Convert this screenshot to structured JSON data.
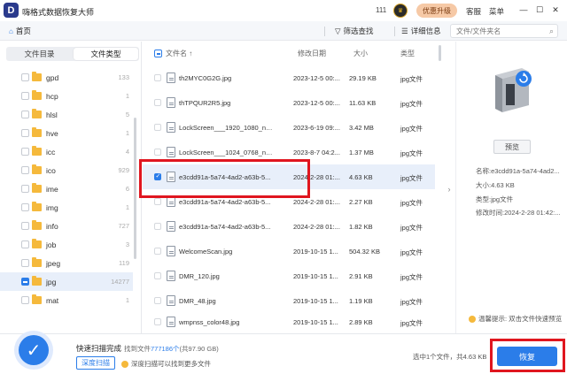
{
  "app": {
    "title": "嗨格式数据恢复大师",
    "logo_letter": "D",
    "count_badge": "111",
    "upgrade_label": "优惠升级",
    "support_label": "客服",
    "menu_label": "菜单"
  },
  "toolbar": {
    "home_label": "首页",
    "filter_label": "筛选查找",
    "details_label": "详细信息",
    "search_placeholder": "文件/文件夹名"
  },
  "left_panel": {
    "tabs": [
      {
        "label": "文件目录",
        "active": false
      },
      {
        "label": "文件类型",
        "active": true
      }
    ],
    "folders": [
      {
        "name": "gpd",
        "count": "133"
      },
      {
        "name": "hcp",
        "count": "1"
      },
      {
        "name": "hlsl",
        "count": "5"
      },
      {
        "name": "hve",
        "count": "1"
      },
      {
        "name": "icc",
        "count": "4"
      },
      {
        "name": "ico",
        "count": "929"
      },
      {
        "name": "ime",
        "count": "6"
      },
      {
        "name": "img",
        "count": "1"
      },
      {
        "name": "info",
        "count": "727"
      },
      {
        "name": "job",
        "count": "3"
      },
      {
        "name": "jpeg",
        "count": "119"
      },
      {
        "name": "jpg",
        "count": "14277"
      },
      {
        "name": "mat",
        "count": "1"
      }
    ]
  },
  "file_table": {
    "headers": {
      "name": "文件名",
      "date": "修改日期",
      "size": "大小",
      "type": "类型"
    },
    "sort_indicator": "↑",
    "rows": [
      {
        "name": "th2MYC0G2G.jpg",
        "date": "2023-12-5 00:...",
        "size": "29.19 KB",
        "type": "jpg文件"
      },
      {
        "name": "thTPQUR2R5.jpg",
        "date": "2023-12-5 00:...",
        "size": "11.63 KB",
        "type": "jpg文件"
      },
      {
        "name": "LockScreen___1920_1080_not...",
        "date": "2023-6-19 09:...",
        "size": "3.42 MB",
        "type": "jpg文件"
      },
      {
        "name": "LockScreen___1024_0768_not...",
        "date": "2023-8-7 04:2...",
        "size": "1.37 MB",
        "type": "jpg文件"
      },
      {
        "name": "e3cdd91a-5a74-4ad2-a63b-5...",
        "date": "2024-2-28 01:...",
        "size": "4.63 KB",
        "type": "jpg文件"
      },
      {
        "name": "e3cdd91a-5a74-4ad2-a63b-5...",
        "date": "2024-2-28 01:...",
        "size": "2.27 KB",
        "type": "jpg文件"
      },
      {
        "name": "e3cdd91a-5a74-4ad2-a63b-5...",
        "date": "2024-2-28 01:...",
        "size": "1.82 KB",
        "type": "jpg文件"
      },
      {
        "name": "WelcomeScan.jpg",
        "date": "2019-10-15 1...",
        "size": "504.32 KB",
        "type": "jpg文件"
      },
      {
        "name": "DMR_120.jpg",
        "date": "2019-10-15 1...",
        "size": "2.91 KB",
        "type": "jpg文件"
      },
      {
        "name": "DMR_48.jpg",
        "date": "2019-10-15 1...",
        "size": "1.19 KB",
        "type": "jpg文件"
      },
      {
        "name": "wmpnss_color48.jpg",
        "date": "2019-10-15 1...",
        "size": "2.89 KB",
        "type": "jpg文件"
      }
    ]
  },
  "preview": {
    "preview_button": "预览",
    "name_line": "名称:e3cdd91a-5a74-4ad2...",
    "size_line": "大小:4.63 KB",
    "type_line": "类型:jpg文件",
    "modified_line": "修改时间:2024-2-28 01:42:...",
    "tip": "温馨提示: 双击文件快速预览"
  },
  "bottom": {
    "scan_done": "快速扫描完成",
    "found_prefix": "找到文件",
    "found_count": "777186个",
    "found_suffix": "(共97.90 GB)",
    "deep_scan_label": "深度扫描",
    "deep_tip": "深度扫描可以找到更多文件",
    "selected_info": "选中1个文件，共4.63 KB",
    "recover_label": "恢复"
  },
  "colors": {
    "accent": "#2b7de9",
    "folder": "#f5b93c",
    "annotation_red": "#e0161f",
    "upgrade_bg": "#f6c9a6"
  }
}
